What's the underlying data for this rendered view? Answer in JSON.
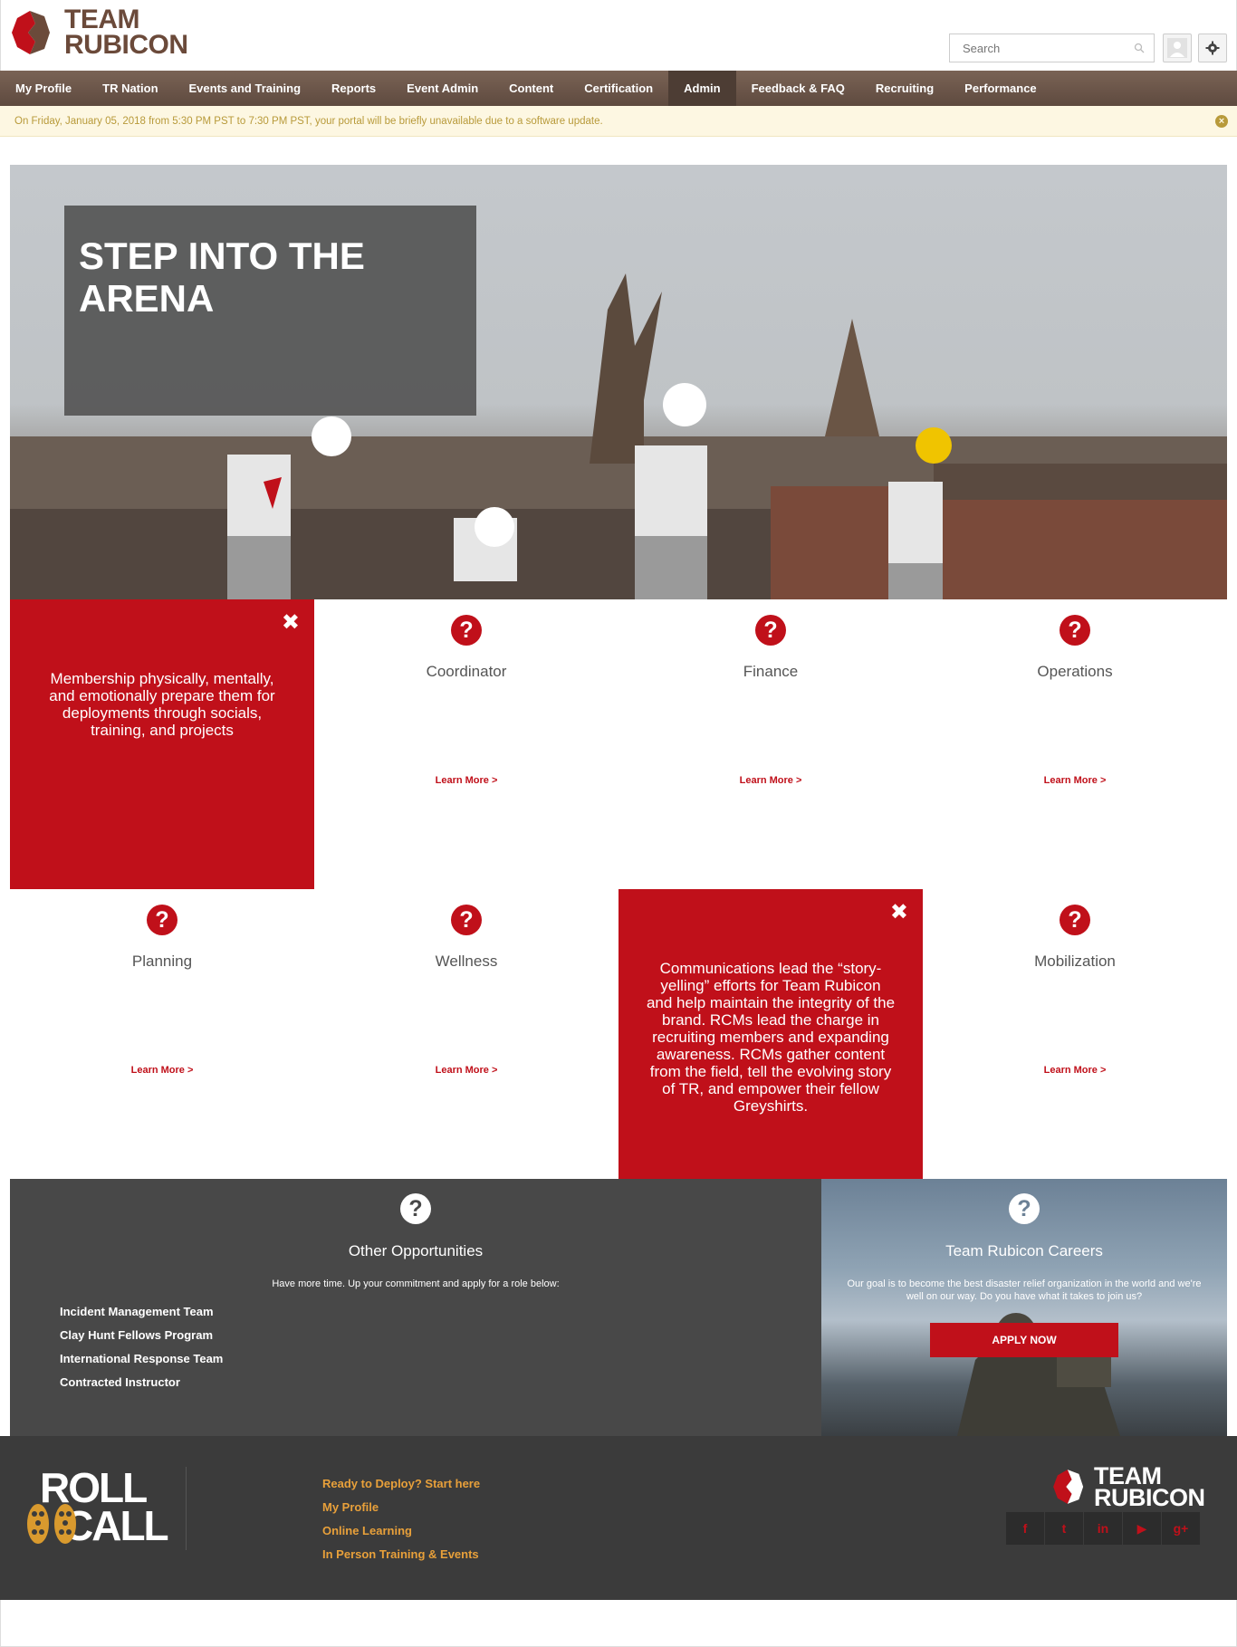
{
  "header": {
    "logo_line1": "TEAM",
    "logo_line2": "RUBICON",
    "search_placeholder": "Search",
    "user_icon": "user-avatar-icon",
    "settings_icon": "gear-icon"
  },
  "nav": {
    "items": [
      {
        "label": "My Profile"
      },
      {
        "label": "TR Nation"
      },
      {
        "label": "Events and Training"
      },
      {
        "label": "Reports"
      },
      {
        "label": "Event Admin"
      },
      {
        "label": "Content"
      },
      {
        "label": "Certification"
      },
      {
        "label": "Admin"
      },
      {
        "label": "Feedback & FAQ"
      },
      {
        "label": "Recruiting"
      },
      {
        "label": "Performance"
      }
    ],
    "active": "Admin"
  },
  "notice": {
    "text": "On Friday, January 05, 2018 from 5:30 PM PST to 7:30 PM PST, your portal will be briefly unavailable due to a software update."
  },
  "hero": {
    "title_line1": "STEP INTO THE",
    "title_line2": "ARENA"
  },
  "tiles": {
    "membership_desc": "Membership physically, mentally, and emotionally prepare them for deployments through socials, training, and projects",
    "coordinator": {
      "title": "Coordinator",
      "link": "Learn More >"
    },
    "finance": {
      "title": "Finance",
      "link": "Learn More >"
    },
    "operations": {
      "title": "Operations",
      "link": "Learn More >"
    },
    "planning": {
      "title": "Planning",
      "link": "Learn More >"
    },
    "wellness": {
      "title": "Wellness",
      "link": "Learn More >"
    },
    "communications_desc": "Communications lead the “story-yelling” efforts for Team Rubicon and help maintain the integrity of the brand. RCMs lead the charge in recruiting members and expanding awareness. RCMs gather content from the field, tell the evolving story of TR, and empower their fellow Greyshirts.",
    "mobilization": {
      "title": "Mobilization",
      "link": "Learn More >"
    },
    "icon_glyph": "?",
    "close_glyph": "✖"
  },
  "other": {
    "title": "Other Opportunities",
    "subtitle": "Have more time. Up your commitment and apply for a role below:",
    "items": [
      "Incident Management Team",
      "Clay Hunt Fellows Program",
      "International Response Team",
      "Contracted Instructor"
    ]
  },
  "careers": {
    "title": "Team Rubicon Careers",
    "subtitle": "Our goal is to become the best disaster relief organization in the world and we're well on our way. Do you have what it takes to join us?",
    "button": "APPLY NOW"
  },
  "footer": {
    "rollcall_line1": "ROLL",
    "rollcall_line2": "CALL",
    "links": [
      "Ready to Deploy? Start here",
      "My Profile",
      "Online Learning",
      "In Person Training & Events"
    ],
    "logo_line1": "TEAM",
    "logo_line2": "RUBICON",
    "social": [
      {
        "icon": "facebook-icon",
        "glyph": "f"
      },
      {
        "icon": "twitter-icon",
        "glyph": "t"
      },
      {
        "icon": "linkedin-icon",
        "glyph": "in"
      },
      {
        "icon": "youtube-icon",
        "glyph": "▶"
      },
      {
        "icon": "googleplus-icon",
        "glyph": "g+"
      }
    ]
  },
  "colors": {
    "brand_red": "#c0101a",
    "nav_brown": "#6b5447",
    "dark_gray": "#484848",
    "footer_bg": "#3b3b3b",
    "accent_orange": "#e8a03a"
  }
}
